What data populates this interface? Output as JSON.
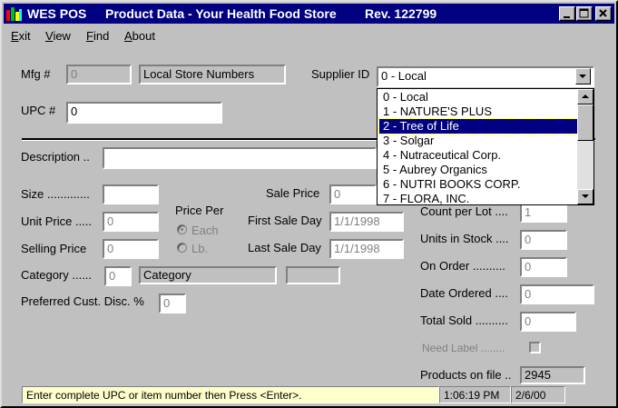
{
  "window": {
    "app_name": "WES POS",
    "title": "Product Data - Your Health Food Store",
    "revision": "Rev.  122799"
  },
  "menu": [
    {
      "accel": "E",
      "rest": "xit"
    },
    {
      "accel": "V",
      "rest": "iew"
    },
    {
      "accel": "F",
      "rest": "ind"
    },
    {
      "accel": "A",
      "rest": "bout"
    }
  ],
  "form": {
    "mfg_label": "Mfg #",
    "mfg_value": "0",
    "mfg_name": "Local Store Numbers",
    "supplier_label": "Supplier ID",
    "supplier_value": "0 - Local",
    "upc_label": "UPC #",
    "upc_value": "0",
    "description_label": "Description ..",
    "description_value": "",
    "size_label": "Size .............",
    "size_value": "",
    "unit_price_label": "Unit Price .....",
    "unit_price_value": "0",
    "selling_price_label": "Selling Price",
    "selling_price_value": "0",
    "price_per_label": "Price Per",
    "price_per_each": "Each",
    "price_per_lb": "Lb.",
    "sale_price_label": "Sale Price",
    "sale_price_value": "0",
    "first_sale_day_label": "First Sale Day",
    "first_sale_day_value": "1/1/1998",
    "last_sale_day_label": "Last Sale Day",
    "last_sale_day_value": "1/1/1998",
    "category_label": "Category ......",
    "category_value": "0",
    "category_name": "Category",
    "category_extra": "",
    "pref_disc_label": "Preferred Cust. Disc. %",
    "pref_disc_value": "0",
    "count_per_lot_label": "Count per Lot ....",
    "count_per_lot_value": "1",
    "units_in_stock_label": "Units in Stock ....",
    "units_in_stock_value": "0",
    "on_order_label": "On Order ..........",
    "on_order_value": "0",
    "date_ordered_label": "Date Ordered ....",
    "date_ordered_value": "0",
    "total_sold_label": "Total Sold ..........",
    "total_sold_value": "0",
    "need_label_label": "Need Label ........",
    "products_on_file_label": "Products on file ..",
    "products_on_file_value": "2945"
  },
  "supplier_options": [
    "0 - Local",
    "1 - NATURE'S PLUS",
    "2 - Tree of Life",
    "3 - Solgar",
    "4 - Nutraceutical Corp.",
    "5 - Aubrey Organics",
    "6 - NUTRI BOOKS CORP.",
    "7 - FLORA, INC."
  ],
  "selected_supplier_index": 2,
  "status": {
    "message": "Enter complete UPC or item number then Press <Enter>.",
    "time": "1:06:19 PM",
    "date": "2/6/00"
  },
  "colors": {
    "titlebar": "#000080",
    "status_message_bg": "#ffffcc",
    "selection": "#000080"
  }
}
